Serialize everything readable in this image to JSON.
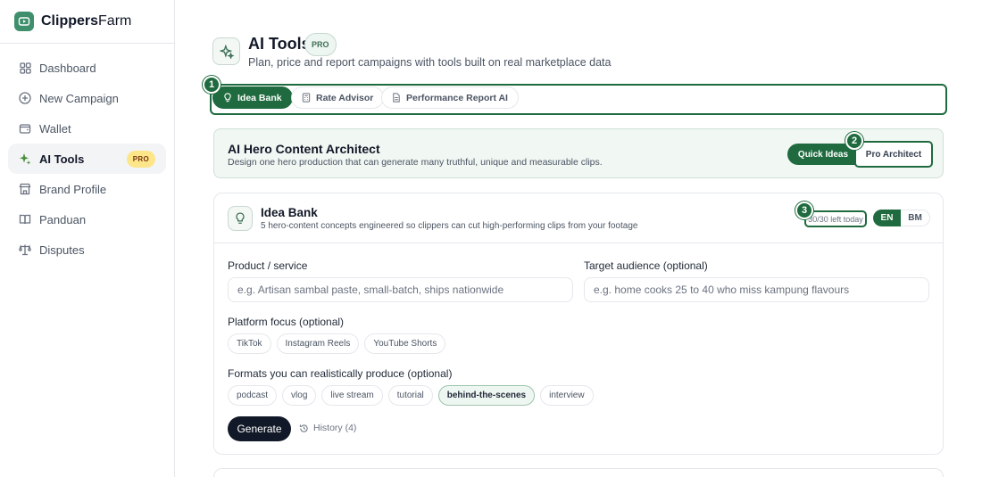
{
  "brand": {
    "name_bold": "Clippers",
    "name_rest": "Farm"
  },
  "sidebar": {
    "items": [
      {
        "label": "Dashboard",
        "icon": "grid-icon"
      },
      {
        "label": "New Campaign",
        "icon": "plus-circle-icon"
      },
      {
        "label": "Wallet",
        "icon": "wallet-icon"
      },
      {
        "label": "AI Tools",
        "icon": "sparkles-icon",
        "badge": "PRO",
        "active": true
      },
      {
        "label": "Brand Profile",
        "icon": "store-icon"
      },
      {
        "label": "Panduan",
        "icon": "book-icon"
      },
      {
        "label": "Disputes",
        "icon": "scale-icon"
      }
    ]
  },
  "header": {
    "title": "AI Tools",
    "badge": "PRO",
    "subtitle": "Plan, price and report campaigns with tools built on real marketplace data"
  },
  "tabs": [
    {
      "label": "Idea Bank",
      "icon": "lightbulb-icon",
      "active": true
    },
    {
      "label": "Rate Advisor",
      "icon": "calculator-icon"
    },
    {
      "label": "Performance Report AI",
      "icon": "file-icon"
    }
  ],
  "markers": [
    "1",
    "2",
    "3"
  ],
  "hero": {
    "title": "AI Hero Content Architect",
    "subtitle": "Design one hero production that can generate many truthful, unique and measurable clips.",
    "mode_quick": "Quick Ideas",
    "mode_pro": "Pro Architect"
  },
  "idea_bank": {
    "title": "Idea Bank",
    "subtitle": "5 hero-content concepts engineered so clippers can cut high-performing clips from your footage",
    "quota": "30/30 left today",
    "lang_en": "EN",
    "lang_bm": "BM",
    "product_label": "Product / service",
    "product_placeholder": "e.g. Artisan sambal paste, small-batch, ships nationwide",
    "product_value": "",
    "audience_label": "Target audience (optional)",
    "audience_placeholder": "e.g. home cooks 25 to 40 who miss kampung flavours",
    "audience_value": "",
    "platform_label": "Platform focus (optional)",
    "platforms": [
      "TikTok",
      "Instagram Reels",
      "YouTube Shorts"
    ],
    "formats_label": "Formats you can realistically produce (optional)",
    "formats": [
      "podcast",
      "vlog",
      "live stream",
      "tutorial",
      "behind-the-scenes",
      "interview"
    ],
    "selected_format": "behind-the-scenes",
    "generate_label": "Generate",
    "history_label": "History (4)"
  },
  "colors": {
    "accent": "#1f6b3f",
    "pro_badge": "#fde68a",
    "brand": "#3f8f6c"
  }
}
